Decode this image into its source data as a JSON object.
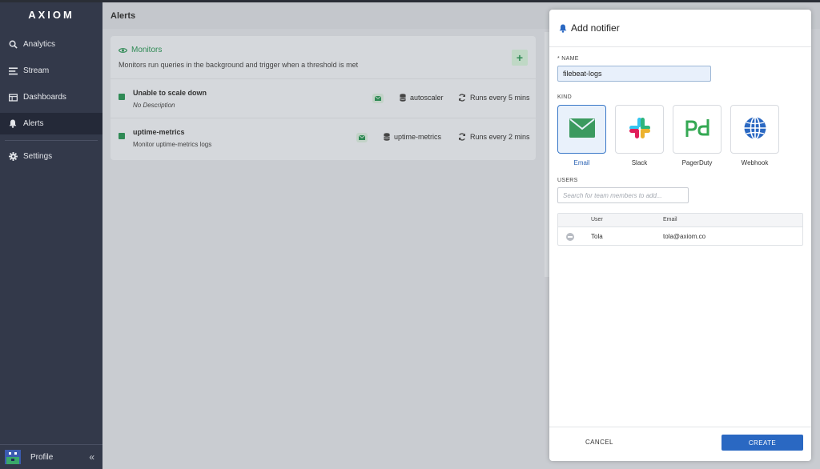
{
  "app": {
    "logo": "AXIOM"
  },
  "sidebar": {
    "items": [
      {
        "label": "Analytics",
        "icon": "search-icon"
      },
      {
        "label": "Stream",
        "icon": "stream-icon"
      },
      {
        "label": "Dashboards",
        "icon": "dashboard-icon"
      },
      {
        "label": "Alerts",
        "icon": "bell-icon",
        "active": true
      },
      {
        "label": "Settings",
        "icon": "gear-icon"
      }
    ],
    "profile_label": "Profile",
    "collapse_glyph": "«"
  },
  "header": {
    "title": "Alerts"
  },
  "monitors": {
    "title": "Monitors",
    "description": "Monitors run queries in the background and trigger when a threshold is met",
    "add_glyph": "+",
    "rows": [
      {
        "name": "Unable to scale down",
        "description": "No Description",
        "dataset": "autoscaler",
        "schedule": "Runs every 5 mins"
      },
      {
        "name": "uptime-metrics",
        "description": "Monitor uptime-metrics logs",
        "dataset": "uptime-metrics",
        "schedule": "Runs every 2 mins"
      }
    ]
  },
  "drawer": {
    "title": "Add notifier",
    "name_label": "* NAME",
    "name_value": "filebeat-logs",
    "kind_label": "KIND",
    "kinds": [
      {
        "label": "Email",
        "selected": true
      },
      {
        "label": "Slack"
      },
      {
        "label": "PagerDuty"
      },
      {
        "label": "Webhook"
      }
    ],
    "users_label": "USERS",
    "users_placeholder": "Search for team members to add...",
    "table": {
      "headers": [
        "User",
        "Email"
      ],
      "rows": [
        {
          "user": "Tola",
          "email": "tola@axiom.co"
        }
      ]
    },
    "cancel_label": "CANCEL",
    "create_label": "CREATE"
  },
  "colors": {
    "accent": "#2a68c2",
    "green": "#2f8a55",
    "sidebar": "#33394a"
  }
}
